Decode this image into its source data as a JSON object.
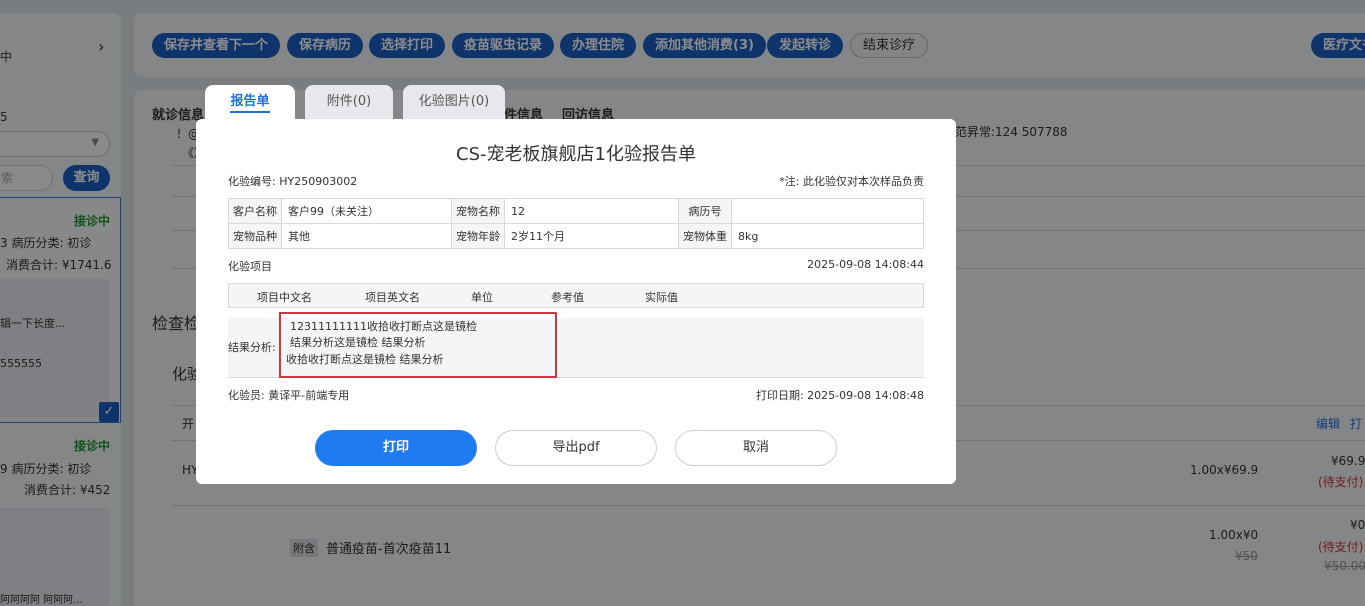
{
  "toolbar": {
    "buttons": [
      "保存并查看下一个",
      "保存病历",
      "选择打印",
      "疫苗驱虫记录",
      "办理住院",
      "添加其他消费(3)",
      "发起转诊"
    ],
    "end_button": "结束诊疗",
    "right_button": "医疗文书"
  },
  "sidebar": {
    "fragment_1": "中",
    "fragment_2": "5",
    "search_placeholder": "索",
    "query_button": "查询",
    "card1": {
      "status": "接诊中",
      "line1": "3  病历分类: 初诊",
      "line2": "消费合计: ¥1741.6",
      "line3": "辑一下长度...",
      "line4": "555555"
    },
    "card2": {
      "status": "接诊中",
      "line1": "9  病历分类: 初诊",
      "line2": "消费合计: ¥452",
      "line3": "阿阿阿阿 阿阿阿..."
    }
  },
  "main": {
    "section_tabs": [
      "就诊信息",
      "件信息",
      "回访信息"
    ],
    "fragment_line1": "！@",
    "fragment_line2": "《》",
    "fragment_right": "范昇常:124 507788",
    "section_title": "检查检",
    "subsection": "化验",
    "col_fragment": "开",
    "row_fragment": "HY",
    "actions": {
      "edit": "编辑",
      "print": "打"
    },
    "row1": {
      "qty_price": "1.00x¥69.9",
      "amount": "¥69.9",
      "status": "(待支付)"
    },
    "row2": {
      "tag": "附含",
      "name": "普通疫苗-首次疫苗11",
      "qty_price": "1.00x¥0",
      "orig": "¥50",
      "amount": "¥0",
      "status": "(待支付)",
      "orig_amount": "¥50.00"
    }
  },
  "dialog": {
    "tabs": {
      "report": "报告单",
      "attachments": "附件(0)",
      "images": "化验图片(0)"
    },
    "title": "CS-宠老板旗舰店1化验报告单",
    "lab_no_label": "化验编号:",
    "lab_no": "HY250903002",
    "note": "*注: 此化验仅对本次样品负责",
    "info": {
      "customer_label": "客户名称",
      "customer": "客户99（未关注）",
      "pet_name_label": "宠物名称",
      "pet_name": "12",
      "record_label": "病历号",
      "record": "",
      "breed_label": "宠物品种",
      "breed": "其他",
      "age_label": "宠物年龄",
      "age": "2岁11个月",
      "weight_label": "宠物体重",
      "weight": "8kg"
    },
    "items_label": "化验项目",
    "items_time": "2025-09-08 14:08:44",
    "columns": [
      "项目中文名",
      "项目英文名",
      "单位",
      "参考值",
      "实际值"
    ],
    "result_label": "结果分析:",
    "result_lines": [
      "12311111111收拾收打断点这是镜检",
      "结果分析这是镜检 结果分析",
      "收拾收打断点这是镜检 结果分析"
    ],
    "examiner_label": "化验员:",
    "examiner": "黄译平-前端专用",
    "print_date_label": "打印日期:",
    "print_date": "2025-09-08 14:08:48",
    "buttons": {
      "print": "打印",
      "export": "导出pdf",
      "cancel": "取消"
    }
  },
  "colors": {
    "primary": "#1f7cf0",
    "toolbar_button": "#1a5fc4",
    "highlight_border": "#d0373b",
    "status_green": "#1f9a2e",
    "pending_red": "#d0373b"
  }
}
